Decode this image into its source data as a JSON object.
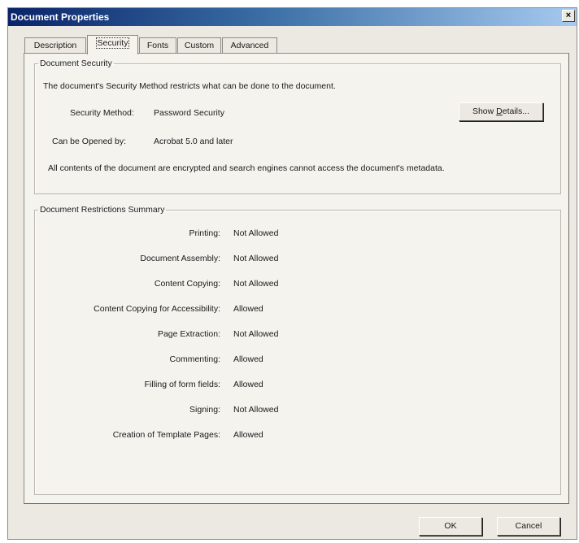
{
  "window": {
    "title": "Document Properties",
    "close_glyph": "×"
  },
  "tabs": [
    {
      "label": "Description",
      "active": false
    },
    {
      "label": "Security",
      "active": true
    },
    {
      "label": "Fonts",
      "active": false
    },
    {
      "label": "Custom",
      "active": false
    },
    {
      "label": "Advanced",
      "active": false
    }
  ],
  "security": {
    "group_title": "Document Security",
    "intro": "The document's Security Method restricts what can be done to the document.",
    "method_label": "Security Method:",
    "method_value": "Password Security",
    "opened_label": "Can be Opened by:",
    "opened_value": "Acrobat 5.0 and later",
    "encryption_note": "All contents of the document are encrypted and search engines cannot access the document's metadata.",
    "show_details_prefix": "Show ",
    "show_details_mnemonic": "D",
    "show_details_suffix": "etails..."
  },
  "restrictions": {
    "group_title": "Document Restrictions Summary",
    "rows": [
      {
        "label": "Printing:",
        "value": "Not Allowed"
      },
      {
        "label": "Document Assembly:",
        "value": "Not Allowed"
      },
      {
        "label": "Content Copying:",
        "value": "Not Allowed"
      },
      {
        "label": "Content Copying for Accessibility:",
        "value": "Allowed"
      },
      {
        "label": "Page Extraction:",
        "value": "Not Allowed"
      },
      {
        "label": "Commenting:",
        "value": "Allowed"
      },
      {
        "label": "Filling of form fields:",
        "value": "Allowed"
      },
      {
        "label": "Signing:",
        "value": "Not Allowed"
      },
      {
        "label": "Creation of Template Pages:",
        "value": "Allowed"
      }
    ]
  },
  "footer": {
    "ok_label": "OK",
    "cancel_label": "Cancel"
  }
}
